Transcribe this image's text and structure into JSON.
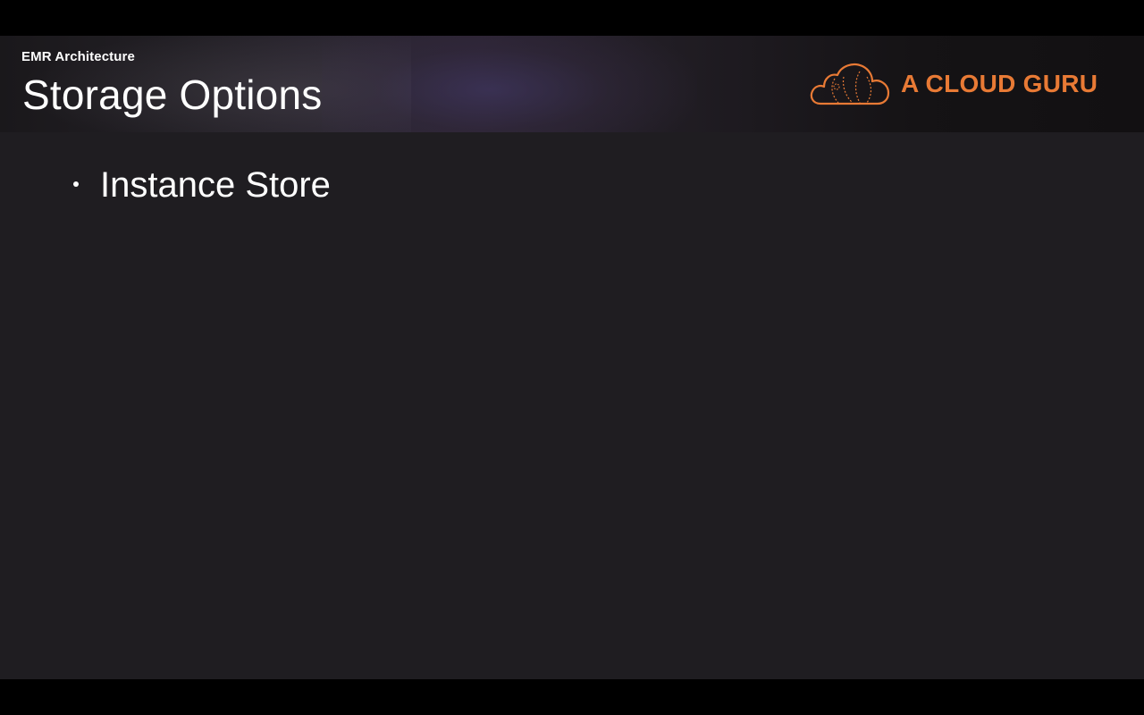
{
  "slide": {
    "section_label": "EMR Architecture",
    "title": "Storage Options",
    "bullets": [
      {
        "text": "Instance Store"
      }
    ]
  },
  "logo": {
    "text": "A CLOUD GURU",
    "icon": "cloud-logo-icon",
    "color": "#e87a35"
  },
  "colors": {
    "slide_background": "#1f1d21",
    "letterbox": "#000000",
    "text": "#ffffff",
    "accent": "#e87a35"
  }
}
